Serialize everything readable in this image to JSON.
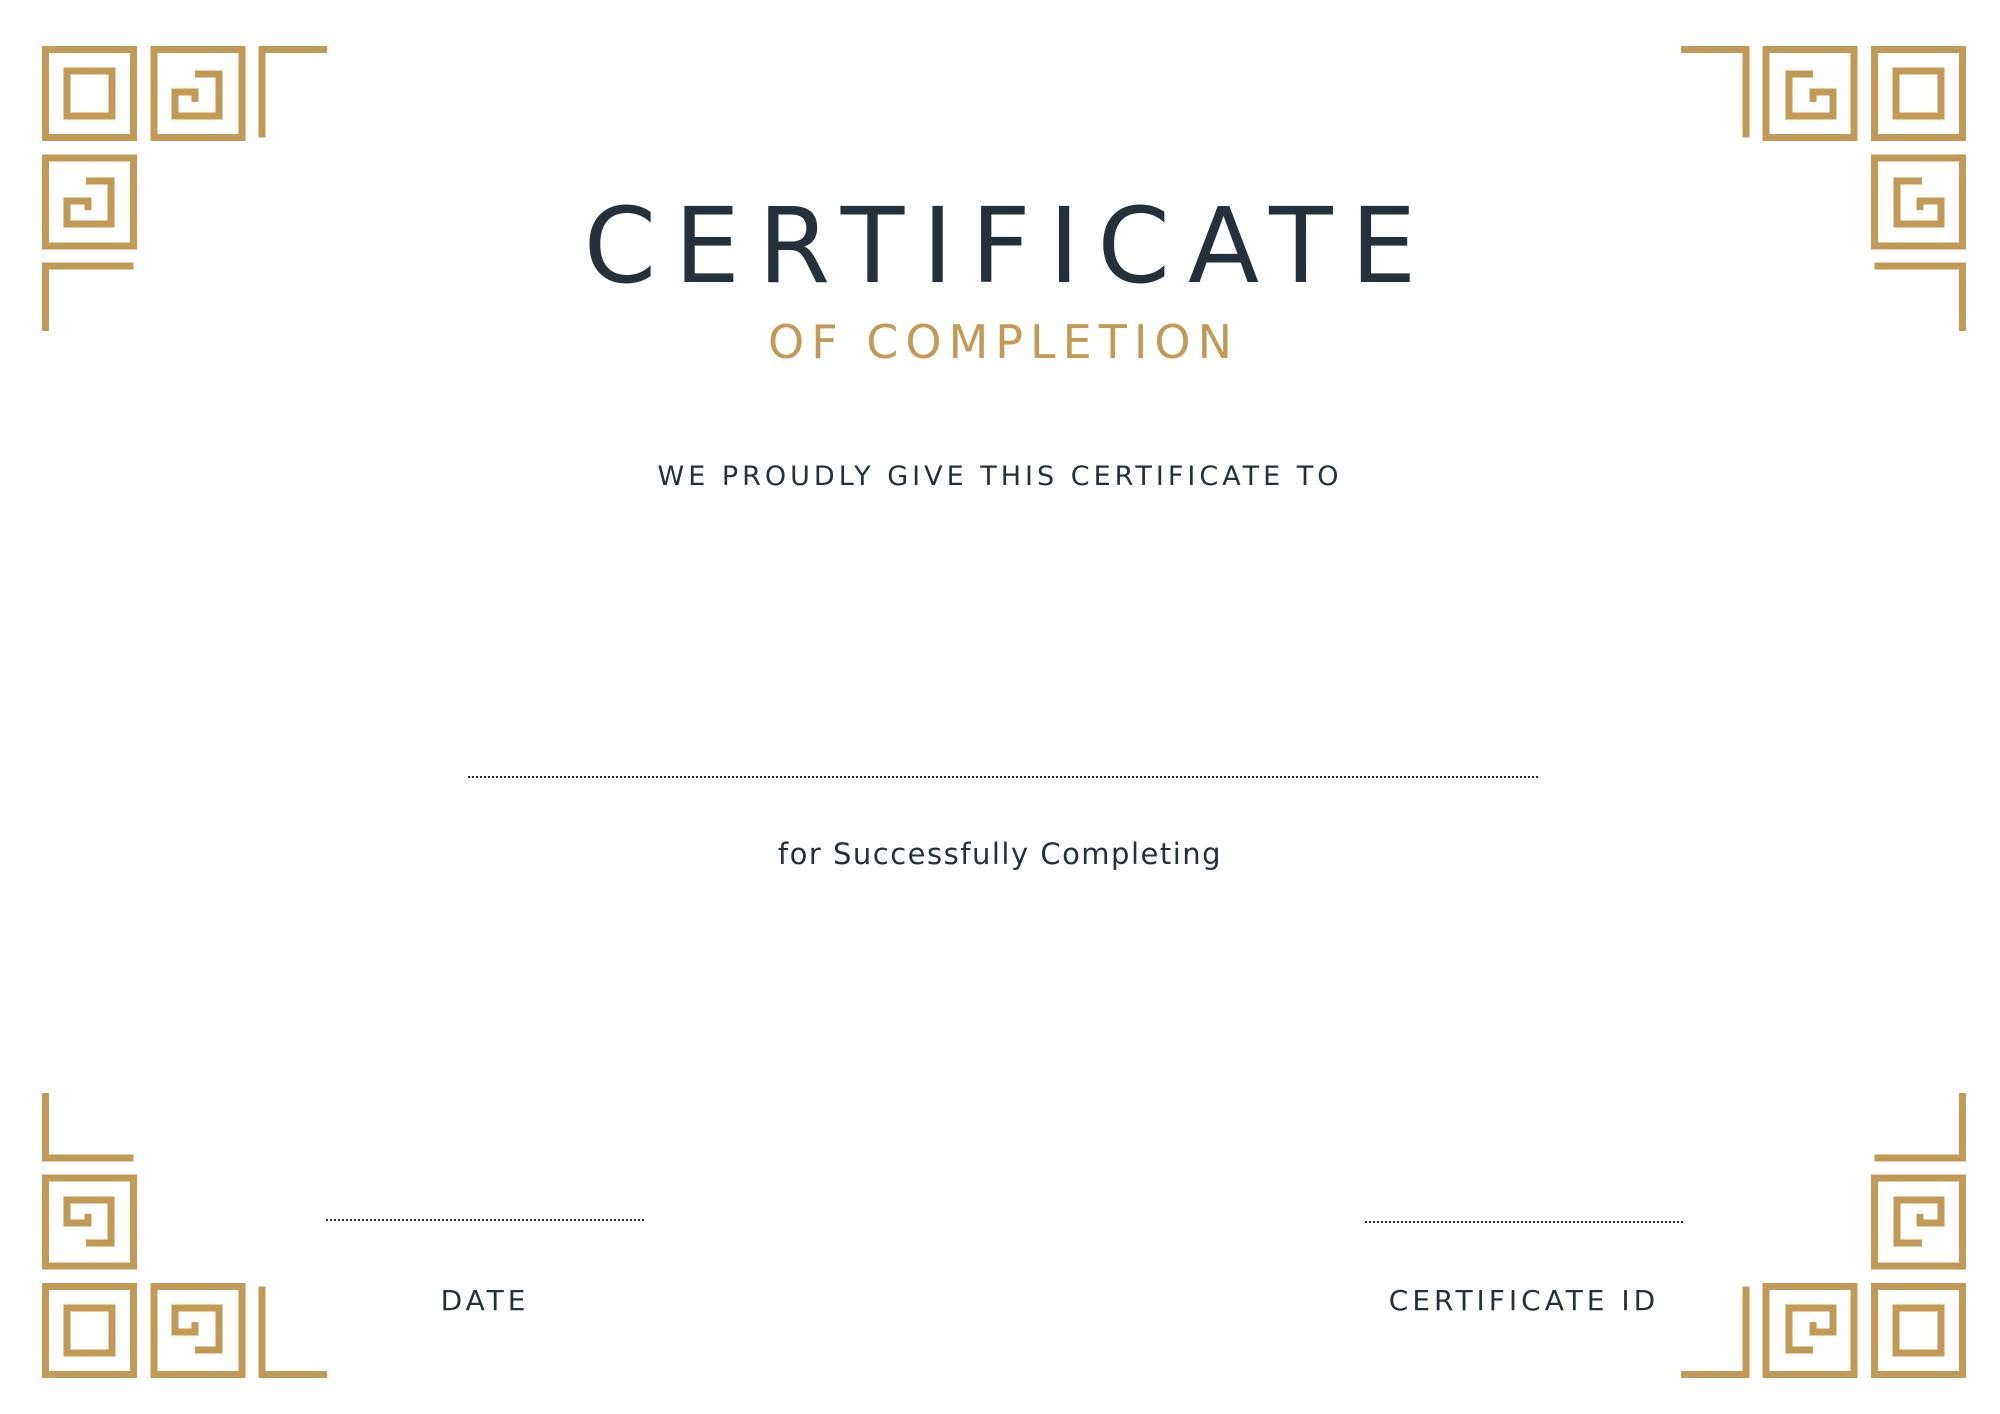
{
  "certificate": {
    "title": "CERTIFICATE",
    "subtitle": "OF COMPLETION",
    "intro": "WE PROUDLY GIVE THIS  CERTIFICATE TO",
    "reason": "for Successfully Completing",
    "date_label": "DATE",
    "id_label": "CERTIFICATE ID"
  },
  "colors": {
    "accent": "#c39a55",
    "text": "#25313a",
    "background": "#ffffff"
  },
  "icons": {
    "corner": "greek-key-ornament-icon"
  }
}
